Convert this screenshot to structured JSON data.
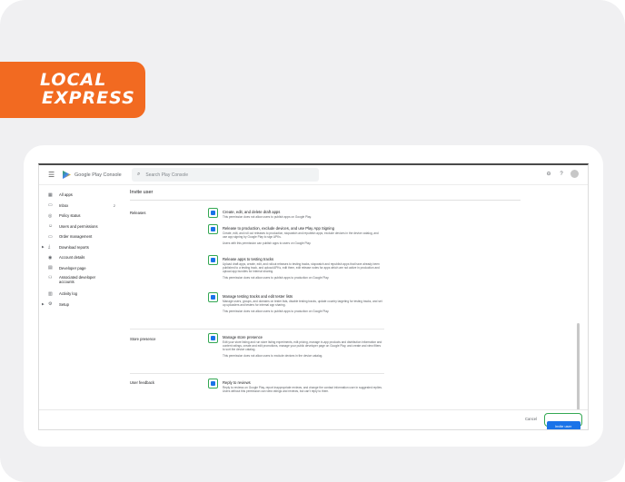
{
  "brand": {
    "line1": "LOCAL",
    "line2": "EXPRESS",
    "color": "#f26a21"
  },
  "console": {
    "app_title": "Google Play Console",
    "search_placeholder": "Search Play Console",
    "top_icons": [
      "link-icon",
      "help-icon",
      "account-avatar"
    ]
  },
  "sidebar": {
    "items": [
      {
        "label": "All apps",
        "icon": "grid-icon"
      },
      {
        "label": "Inbox",
        "icon": "inbox-icon",
        "badge": "2"
      },
      {
        "label": "Policy status",
        "icon": "shield-icon"
      },
      {
        "label": "Users and permissions",
        "icon": "people-icon"
      },
      {
        "label": "Order management",
        "icon": "card-icon"
      },
      {
        "label": "Download reports",
        "icon": "download-icon",
        "expandable": true
      },
      {
        "label": "Account details",
        "icon": "account-icon"
      },
      {
        "label": "Developer page",
        "icon": "page-icon"
      },
      {
        "label": "Associated developer accounts",
        "icon": "link-accounts-icon"
      },
      {
        "label": "Activity log",
        "icon": "log-icon"
      },
      {
        "label": "Setup",
        "icon": "gear-icon",
        "expandable": true
      }
    ]
  },
  "main": {
    "title": "Invite user",
    "sections": [
      {
        "label": "Releases"
      },
      {
        "label": "Store presence"
      },
      {
        "label": "User feedback"
      }
    ],
    "permissions": [
      {
        "title": "Create, edit, and delete draft apps",
        "desc": "This permission does not allow users to publish apps on Google Play.",
        "note": "",
        "checked": true
      },
      {
        "title": "Release to production, exclude devices, and use Play App Signing",
        "desc": "Create, edit, and roll out releases to production, stopwatch and republish apps, exclude devices in the device catalog, and use app signing by Google Play to sign APKs.",
        "note": "Users with this permission can publish apps to users on Google Play.",
        "checked": true
      },
      {
        "title": "Release apps to testing tracks",
        "desc": "Upload draft apps, create, edit, and rollout releases to testing tracks, stopwatch and republish apps that have already been published to a testing track, and upload APKs, edit them, edit release notes for apps which are not active in production and upload app bundles for internal sharing.",
        "note": "This permission does not allow users to publish apps to production on Google Play.",
        "checked": true
      },
      {
        "title": "Manage testing tracks and edit tester lists",
        "desc": "Manage users, groups, and domains on tester lists, disable testing tracks, update country targeting for testing tracks, and set up uploaders and testers for internal app sharing.",
        "note": "This permission does not allow users to publish apps to production on Google Play.",
        "checked": true
      },
      {
        "title": "Manage store presence",
        "desc": "Edit your store listing and run store listing experiments, edit pricing, manage in-app products and distribution information and content ratings, create and edit promotions, manage your public developer page on Google Play, and create and view filters to sort the device catalog.",
        "note": "This permission does not allow users to exclude devices in the device catalog.",
        "checked": true
      },
      {
        "title": "Reply to reviews",
        "desc": "Reply to reviews on Google Play, report inappropriate reviews, and change the contact information user in suggested replies. Users without this permission can view ratings and reviews, but can't reply to them.",
        "note": "",
        "checked": true
      }
    ]
  },
  "footer": {
    "cancel_label": "Cancel",
    "invite_label": "Invite user"
  },
  "colors": {
    "accent": "#1a73e8",
    "highlight": "#34a853"
  }
}
